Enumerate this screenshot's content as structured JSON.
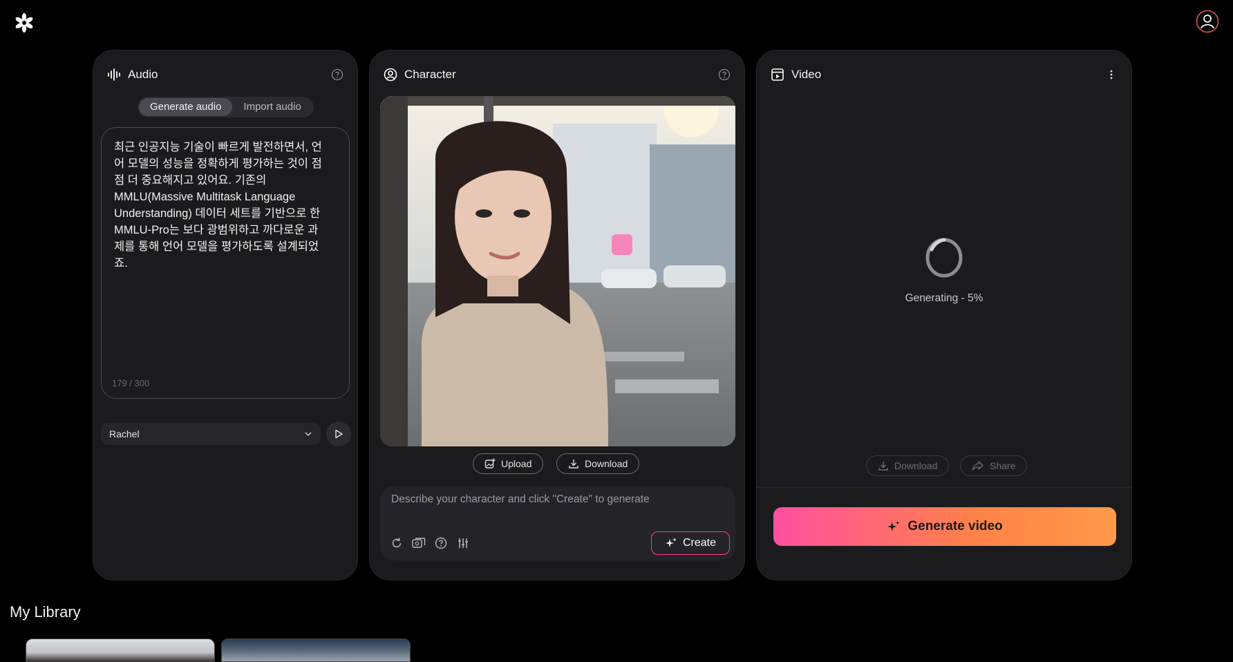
{
  "audio": {
    "title": "Audio",
    "tabs": [
      {
        "label": "Generate audio",
        "active": true
      },
      {
        "label": "Import audio",
        "active": false
      }
    ],
    "text": "최근 인공지능 기술이 빠르게 발전하면서, 언\n어 모델의 성능을 정확하게 평가하는 것이 점\n점 더 중요해지고 있어요. 기존의\nMMLU(Massive Multitask Language\nUnderstanding) 데이터 세트를 기반으로 한\nMMLU-Pro는 보다 광범위하고 까다로운 과\n제를 통해 언어 모델을 평가하도록 설계되었\n죠.",
    "counter": "179 / 300",
    "voice": "Rachel"
  },
  "character": {
    "title": "Character",
    "upload_label": "Upload",
    "download_label": "Download",
    "prompt_placeholder": "Describe your character and click \"Create\" to generate",
    "create_label": "Create"
  },
  "video": {
    "title": "Video",
    "status": "Generating - 5%",
    "progress": 0.05,
    "download_label": "Download",
    "share_label": "Share",
    "generate_label": "Generate video"
  },
  "library": {
    "title": "My Library"
  },
  "colors": {
    "accent_pink": "#ff3f86",
    "gradient_start": "#ff4fa0",
    "gradient_end": "#ff9a4a",
    "panel_bg": "#1b1b1d"
  }
}
